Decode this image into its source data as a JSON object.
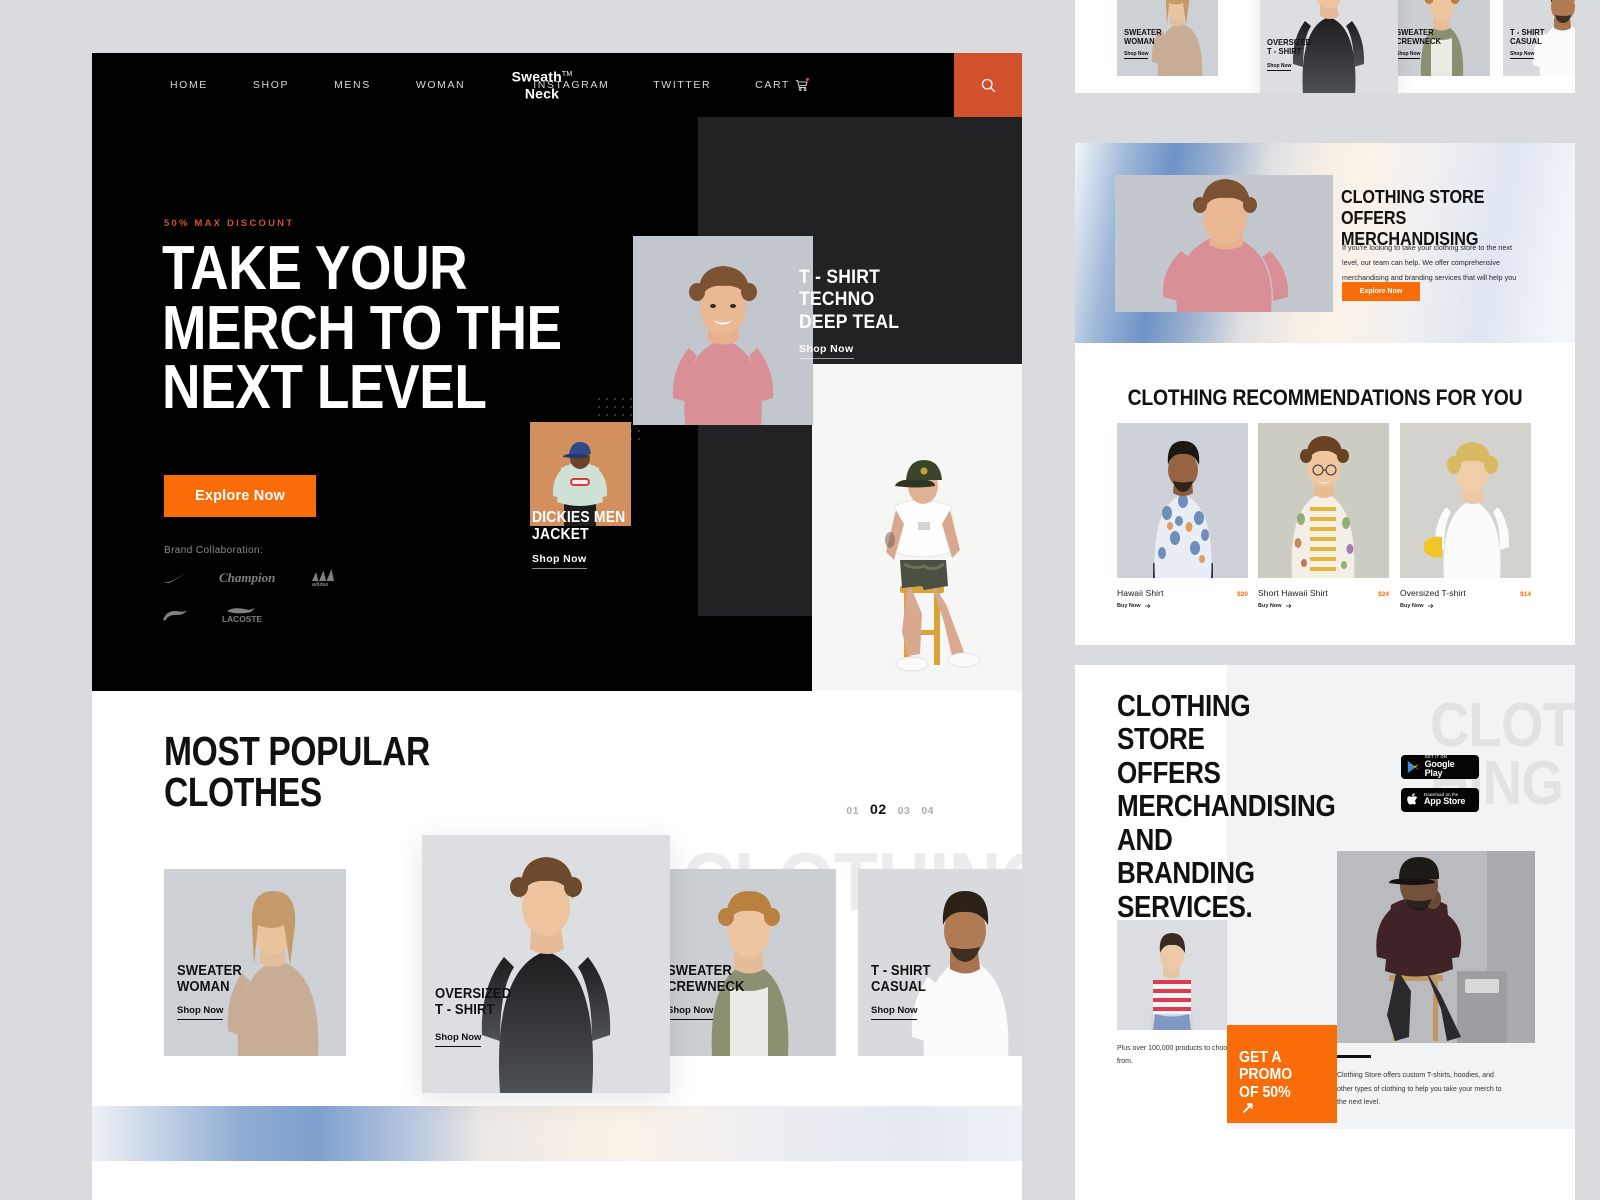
{
  "site": {
    "logo_name": "Sweath",
    "logo_tm": "TM",
    "logo_sub": "Neck"
  },
  "nav": {
    "left_links": [
      "HOME",
      "SHOP",
      "MENS",
      "WOMAN"
    ],
    "right_links": [
      "INSTAGRAM",
      "TWITTER"
    ],
    "cart_label": "CART",
    "search_icon": "search-icon"
  },
  "hero": {
    "eyebrow": "50% MAX DISCOUNT",
    "title": "TAKE YOUR\nMERCH TO THE\nNEXT LEVEL",
    "cta_label": "Explore Now",
    "brand_label": "Brand Collaboration:",
    "brands": [
      "Nike",
      "Champion",
      "adidas",
      "Puma",
      "LACOSTE"
    ],
    "cards": [
      {
        "title": "T - SHIRT\nTECHNO\nDEEP TEAL",
        "shop": "Shop Now"
      },
      {
        "title": "DICKIES MEN\nJACKET",
        "shop": "Shop Now"
      }
    ]
  },
  "popular": {
    "title": "MOST POPULAR\nCLOTHES",
    "ghost_word": "CLOTHING",
    "pager": [
      "01",
      "02",
      "03",
      "04"
    ],
    "pager_active": "02",
    "cards": [
      {
        "title": "SWEATER\nWOMAN",
        "shop": "Shop Now"
      },
      {
        "title": "OVERSIZED\nT - SHIRT",
        "shop": "Shop Now"
      },
      {
        "title": "SWEATER\nCREWNECK",
        "shop": "Shop Now"
      },
      {
        "title": "T - SHIRT\nCASUAL",
        "shop": "Shop Now"
      }
    ]
  },
  "right_top_cards": [
    {
      "title": "SWEATER\nWOMAN",
      "shop": "Shop Now"
    },
    {
      "title": "OVERSIZED\nT - SHIRT",
      "shop": "Shop Now"
    },
    {
      "title": "SWEATER\nCREWNECK",
      "shop": "Shop Now"
    },
    {
      "title": "T - SHIRT\nCASUAL",
      "shop": "Shop Now"
    }
  ],
  "offers": {
    "title": "CLOTHING STORE OFFERS\nMERCHANDISING",
    "body": "If you're looking to take your clothing store to the next level, our team can help. We offer comprehensive merchandising and branding services that will help you",
    "cta_label": "Explore Now"
  },
  "recommendations": {
    "title": "CLOTHING RECOMMENDATIONS FOR YOU",
    "items": [
      {
        "name": "Hawaii Shirt",
        "price": "$20",
        "buy": "Buy Now"
      },
      {
        "name": "Short Hawaii Shirt",
        "price": "$24",
        "buy": "Buy Now"
      },
      {
        "name": "Oversized T-shirt",
        "price": "$14",
        "buy": "Buy Now"
      }
    ]
  },
  "cta": {
    "title": "CLOTHING STORE\nOFFERS\nMERCHANDISING\nAND BRANDING\nSERVICES.",
    "ghost": "CLOT\nHING",
    "badges": [
      {
        "small": "GET IT ON",
        "big": "Google Play",
        "icon": "google-play-icon"
      },
      {
        "small": "Download on the",
        "big": "App Store",
        "icon": "apple-icon"
      }
    ],
    "plus_text": "Plus over 100,000 products to choose from.",
    "promo_text": "GET A PROMO\nOF 50%",
    "promo_arrow": "↗",
    "body": "Clothing Store offers custom T-shirts, hoodies, and other types of clothing to help you take your merch to the next level."
  },
  "colors": {
    "accent_orange": "#f86c09",
    "search_orange": "#d1512c",
    "dark": "#000000",
    "page_bg": "#d9dbdf"
  }
}
